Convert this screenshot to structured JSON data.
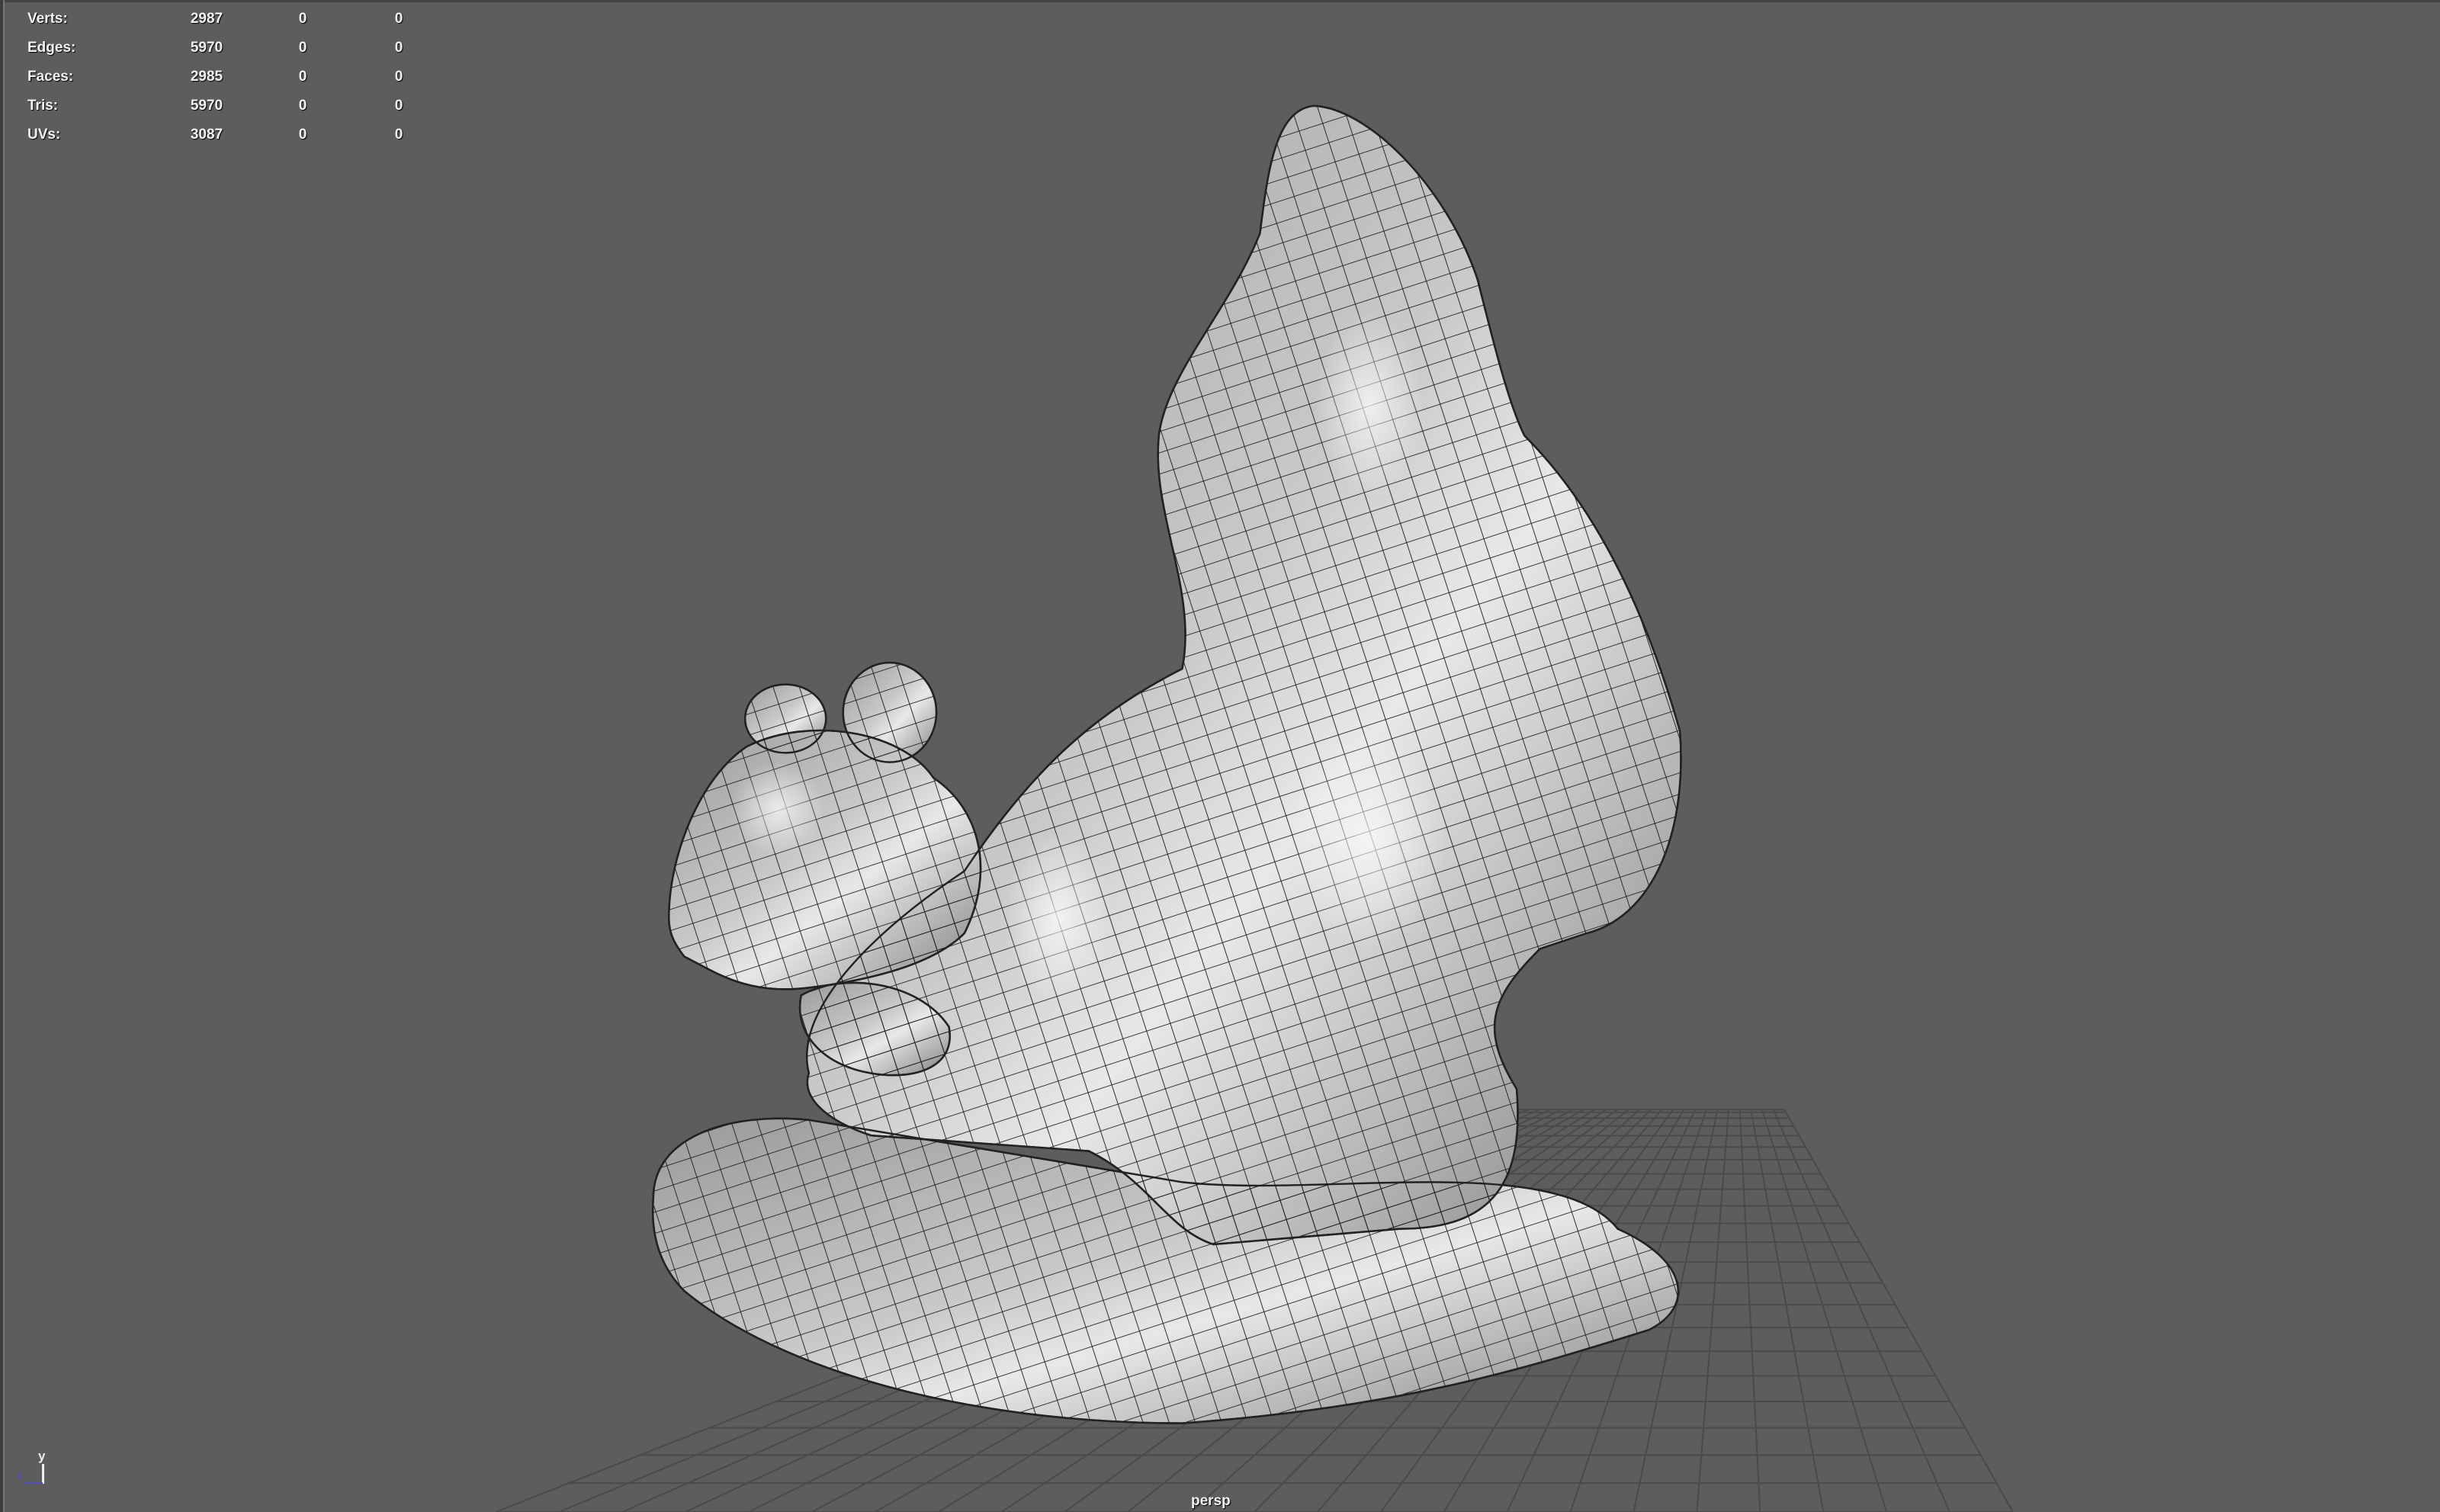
{
  "hud": {
    "rows": [
      {
        "label": "Verts:",
        "values": [
          "2987",
          "0",
          "0"
        ]
      },
      {
        "label": "Edges:",
        "values": [
          "5970",
          "0",
          "0"
        ]
      },
      {
        "label": "Faces:",
        "values": [
          "2985",
          "0",
          "0"
        ]
      },
      {
        "label": "Tris:",
        "values": [
          "5970",
          "0",
          "0"
        ]
      },
      {
        "label": "UVs:",
        "values": [
          "3087",
          "0",
          "0"
        ]
      }
    ]
  },
  "camera": {
    "name": "persp"
  },
  "axis": {
    "y": "y",
    "z": "z"
  },
  "colors": {
    "background": "#5d5d5d",
    "grid": "#4a4a4a",
    "mesh": "#1e1e1e",
    "axis_z": "#5050c0"
  }
}
